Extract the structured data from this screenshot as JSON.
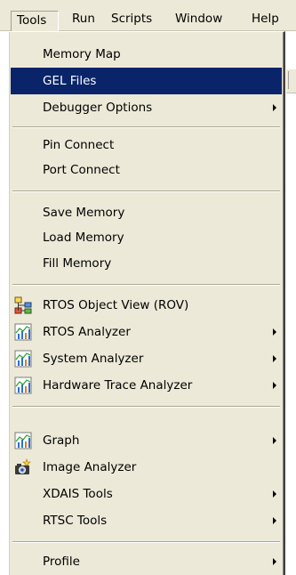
{
  "menubar": {
    "items": [
      "Tools",
      "Run",
      "Scripts",
      "Window",
      "Help"
    ]
  },
  "tools_menu": {
    "items": [
      {
        "label": "Memory Map",
        "icon": "",
        "submenu": false
      },
      {
        "label": "GEL Files",
        "icon": "",
        "submenu": false,
        "selected": true
      },
      {
        "label": "Debugger Options",
        "icon": "",
        "submenu": true
      },
      {
        "label": "Pin Connect",
        "icon": "",
        "submenu": false
      },
      {
        "label": "Port Connect",
        "icon": "",
        "submenu": false
      },
      {
        "label": "Save Memory",
        "icon": "",
        "submenu": false
      },
      {
        "label": "Load Memory",
        "icon": "",
        "submenu": false
      },
      {
        "label": "Fill Memory",
        "icon": "",
        "submenu": false
      },
      {
        "label": "RTOS Object View (ROV)",
        "icon": "object-tree-icon",
        "submenu": false
      },
      {
        "label": "RTOS Analyzer",
        "icon": "analyzer-chart-icon",
        "submenu": true
      },
      {
        "label": "System Analyzer",
        "icon": "analyzer-chart-icon",
        "submenu": true
      },
      {
        "label": "Hardware Trace Analyzer",
        "icon": "analyzer-chart-icon",
        "submenu": true
      },
      {
        "label": "Graph",
        "icon": "analyzer-chart-icon",
        "submenu": true
      },
      {
        "label": "Image Analyzer",
        "icon": "camera-icon",
        "submenu": false
      },
      {
        "label": "XDAIS Tools",
        "icon": "",
        "submenu": true
      },
      {
        "label": "RTSC Tools",
        "icon": "",
        "submenu": true
      },
      {
        "label": "Profile",
        "icon": "",
        "submenu": true
      }
    ]
  },
  "colors": {
    "menu_background": "#ece9d8",
    "selection_background": "#0a246a",
    "selection_text": "#ffffff"
  }
}
